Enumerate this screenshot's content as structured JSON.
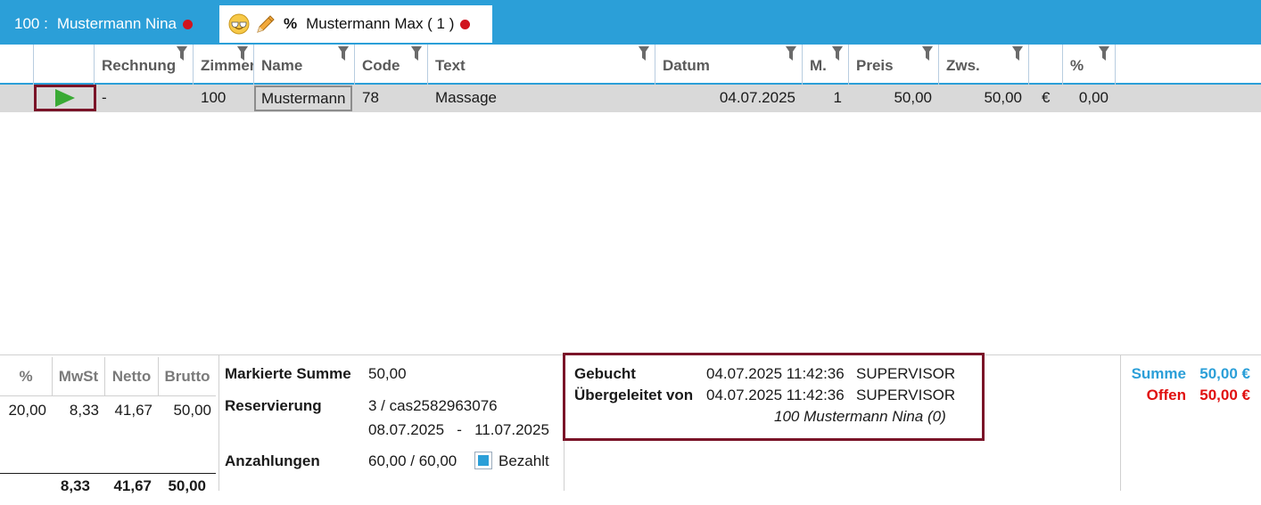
{
  "tabs": [
    {
      "number": "100 :",
      "label": "Mustermann Nina"
    },
    {
      "percent": "%",
      "label": "Mustermann Max ( 1 )"
    }
  ],
  "grid": {
    "columns": [
      "Rechnung",
      "Zimmer",
      "Name",
      "Code",
      "Text",
      "Datum",
      "M.",
      "Preis",
      "Zws.",
      "",
      "%"
    ],
    "rows": [
      {
        "rechnung": "-",
        "zimmer": "100",
        "name": "Mustermann",
        "code": "78",
        "text": "Massage",
        "datum": "04.07.2025",
        "menge": "1",
        "preis": "50,00",
        "zws": "50,00",
        "currency": "€",
        "pct": "0,00"
      }
    ]
  },
  "tax": {
    "headers": [
      "%",
      "MwSt",
      "Netto",
      "Brutto"
    ],
    "rows": [
      {
        "pct": "20,00",
        "mwst": "8,33",
        "netto": "41,67",
        "brutto": "50,00"
      }
    ],
    "totals": {
      "mwst": "8,33",
      "netto": "41,67",
      "brutto": "50,00"
    }
  },
  "summary": {
    "markierte_summe_label": "Markierte Summe",
    "markierte_summe": "50,00",
    "reservierung_label": "Reservierung",
    "reservierung": "3 / cas2582963076",
    "reservierung_dates": "08.07.2025   -   11.07.2025",
    "anzahlungen_label": "Anzahlungen",
    "anzahlungen": "60,00 / 60,00",
    "bezahlt_label": "Bezahlt",
    "bezahlt_checked": true
  },
  "booking": {
    "gebucht_label": "Gebucht",
    "gebucht_datetime": "04.07.2025 11:42:36",
    "gebucht_user": "SUPERVISOR",
    "uebergeleitet_label": "Übergeleitet von",
    "uebergeleitet_datetime": "04.07.2025 11:42:36",
    "uebergeleitet_user": "SUPERVISOR",
    "source": "100 Mustermann Nina (0)"
  },
  "totals": {
    "summe_label": "Summe",
    "summe": "50,00 €",
    "offen_label": "Offen",
    "offen": "50,00 €"
  },
  "colors": {
    "accent": "#2b9fd8",
    "highlight": "#7a1428",
    "offen": "#e01010",
    "status_dot": "#d0141e",
    "play": "#3aaa35"
  }
}
